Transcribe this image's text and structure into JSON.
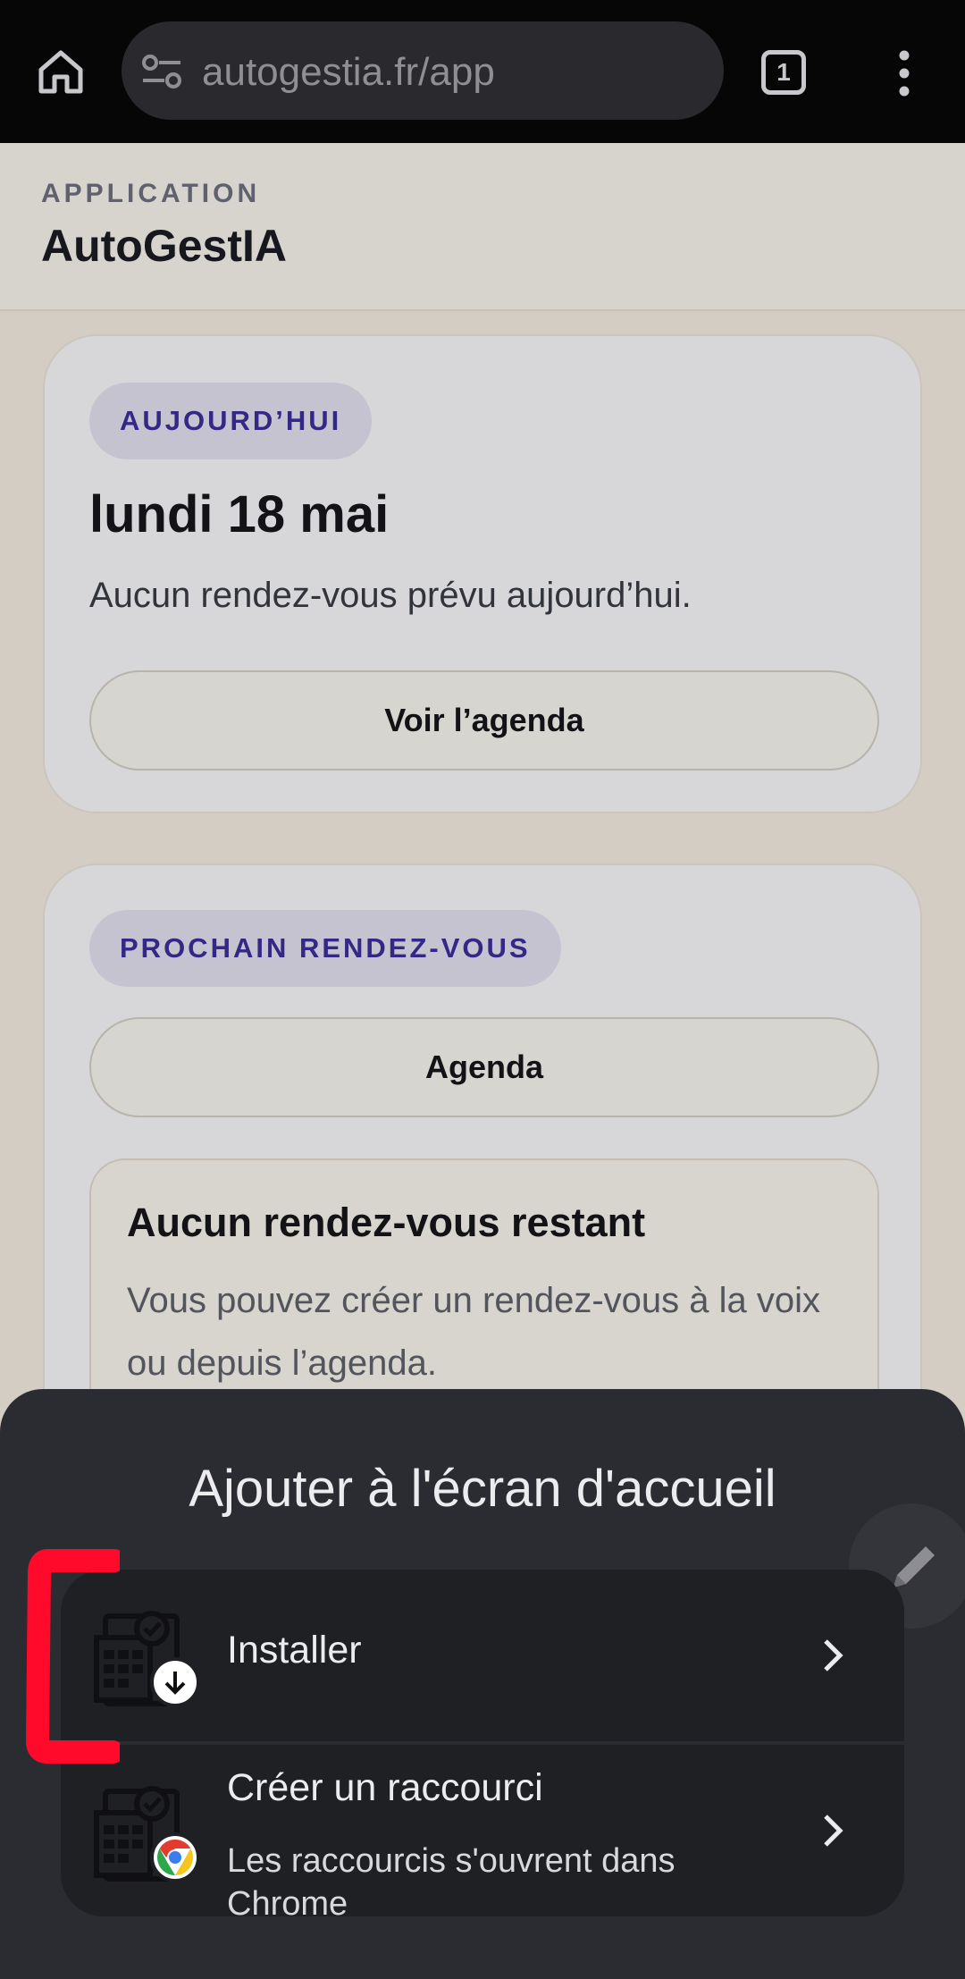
{
  "browser": {
    "url": "autogestia.fr/app",
    "tab_count": "1"
  },
  "header": {
    "eyebrow": "APPLICATION",
    "title": "AutoGestIA"
  },
  "today_card": {
    "pill": "AUJOURD’HUI",
    "date": "lundi 18 mai",
    "subtitle": "Aucun rendez-vous prévu aujourd’hui.",
    "button": "Voir l’agenda"
  },
  "next_card": {
    "pill": "PROCHAIN RENDEZ-VOUS",
    "button": "Agenda",
    "empty_title": "Aucun rendez-vous restant",
    "empty_text": "Vous pouvez créer un rendez-vous à la voix ou depuis l’agenda."
  },
  "sheet": {
    "title": "Ajouter à l'écran d'accueil",
    "options": [
      {
        "label": "Installer",
        "icon": "download-icon"
      },
      {
        "label": "Créer un raccourci",
        "subtitle": "Les raccourcis s'ouvrent dans Chrome",
        "icon": "chrome-icon"
      }
    ]
  },
  "colors": {
    "accent": "#3d2f9e",
    "annotation": "#ff0a2a",
    "sheet_bg": "#2b2c31"
  }
}
